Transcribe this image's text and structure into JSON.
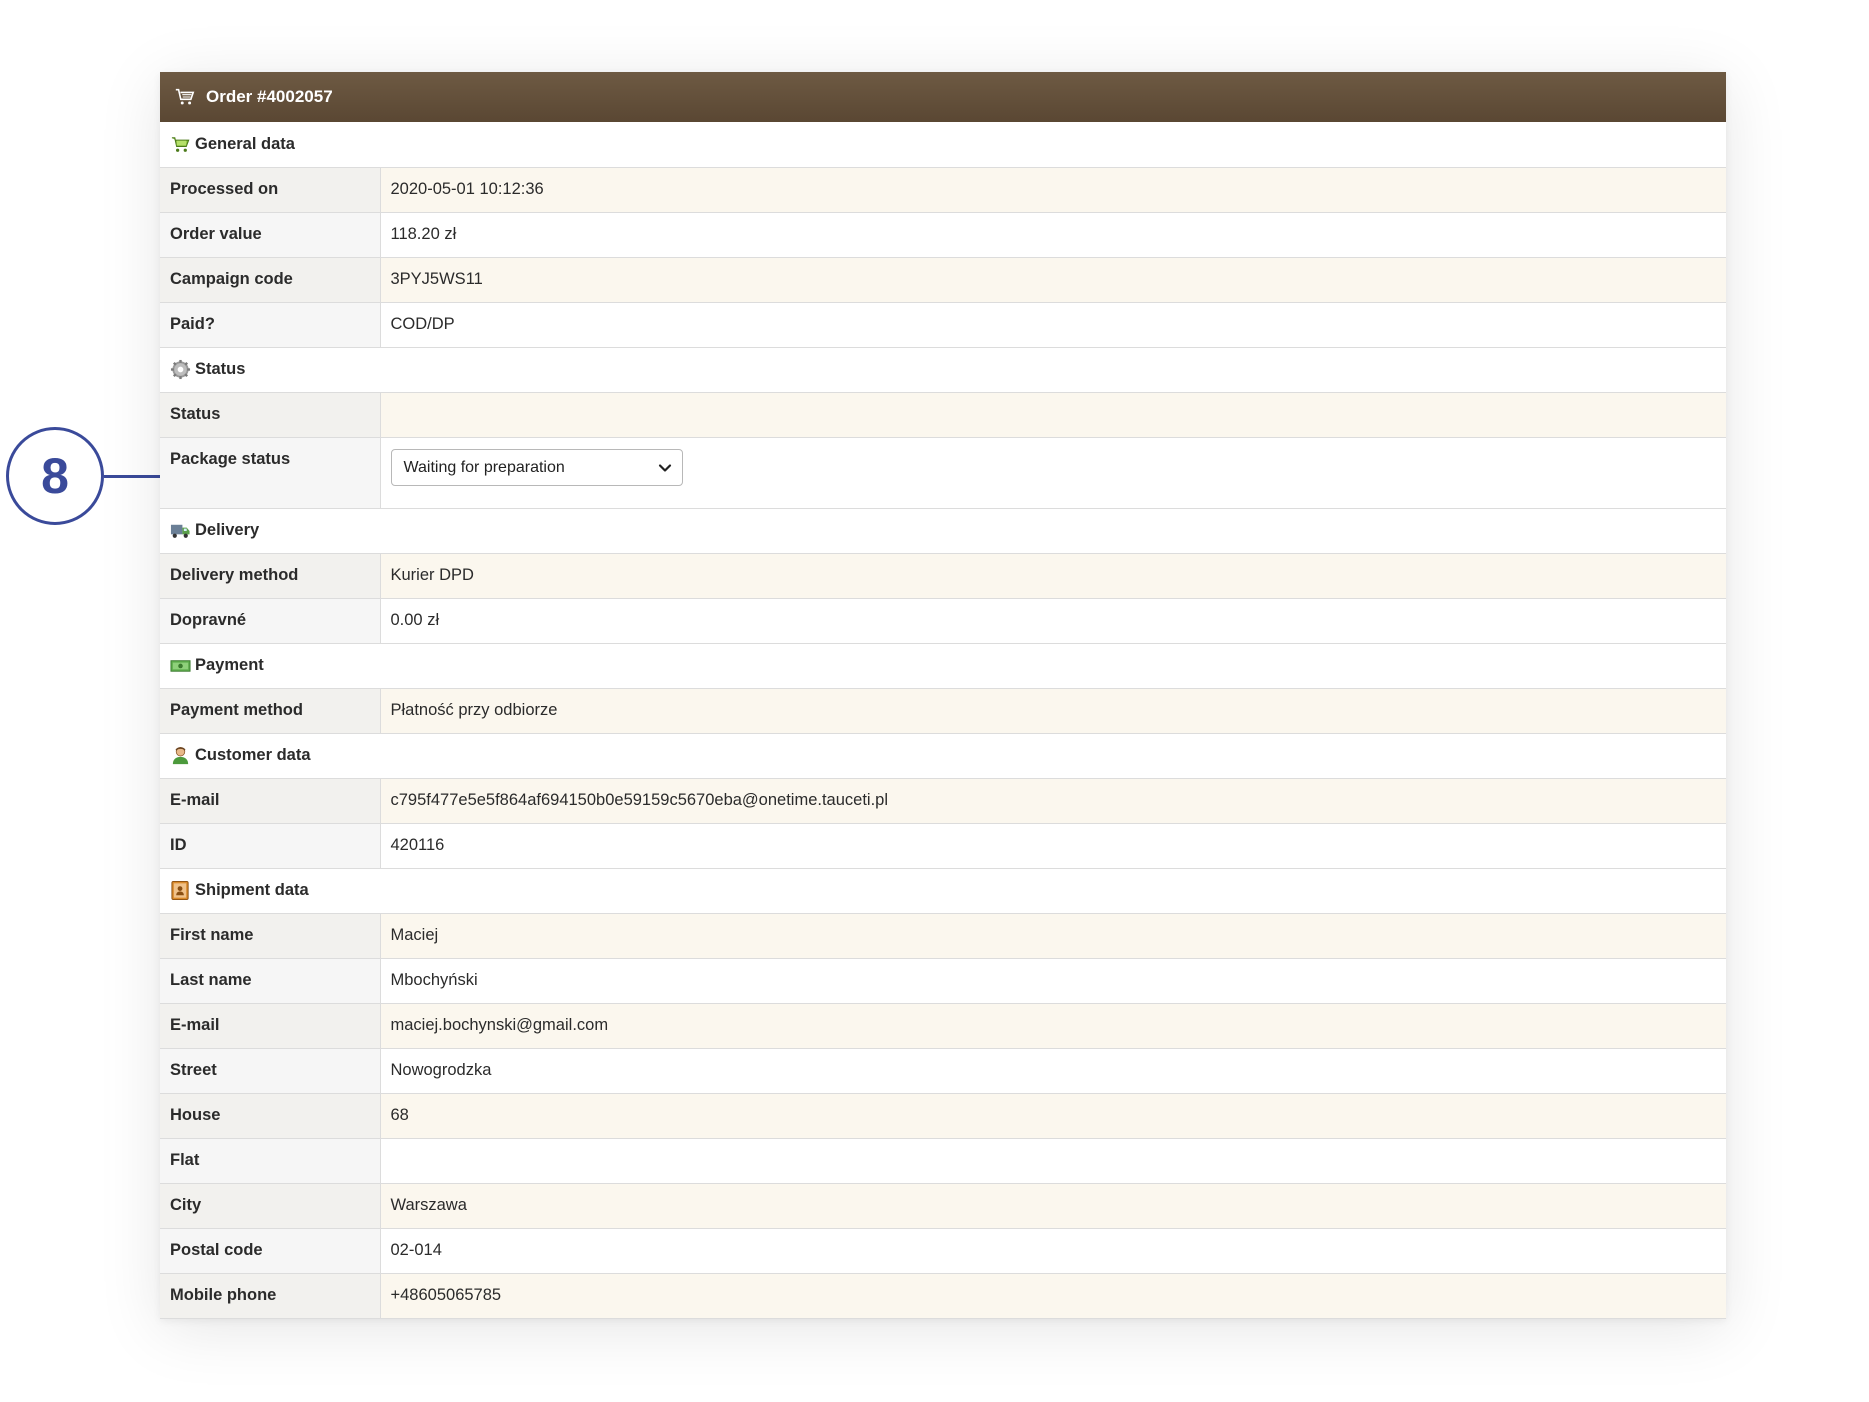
{
  "window": {
    "title": "Order #4002057",
    "title_icon": "cart-icon"
  },
  "callout": {
    "number": "8"
  },
  "sections": {
    "general": {
      "title": "General data",
      "icon": "cart-green-icon",
      "rows": [
        {
          "label": "Processed on",
          "value": "2020-05-01 10:12:36"
        },
        {
          "label": "Order value",
          "value": "118.20 zł"
        },
        {
          "label": "Campaign code",
          "value": "3PYJ5WS11"
        },
        {
          "label": "Paid?",
          "value": "COD/DP"
        }
      ]
    },
    "status": {
      "title": "Status",
      "icon": "gear-icon",
      "rows": [
        {
          "label": "Status",
          "value": ""
        },
        {
          "label": "Package status",
          "selected": "Waiting for preparation"
        }
      ]
    },
    "delivery": {
      "title": "Delivery",
      "icon": "truck-icon",
      "rows": [
        {
          "label": "Delivery method",
          "value": "Kurier DPD"
        },
        {
          "label": "Dopravné",
          "value": "0.00 zł"
        }
      ]
    },
    "payment": {
      "title": "Payment",
      "icon": "banknote-icon",
      "rows": [
        {
          "label": "Payment method",
          "value": "Płatność przy odbiorze"
        }
      ]
    },
    "customer": {
      "title": "Customer data",
      "icon": "user-icon",
      "rows": [
        {
          "label": "E-mail",
          "value": "c795f477e5e5f864af694150b0e59159c5670eba@onetime.tauceti.pl"
        },
        {
          "label": "ID",
          "value": "420116"
        }
      ]
    },
    "shipment": {
      "title": "Shipment data",
      "icon": "address-book-icon",
      "rows": [
        {
          "label": "First name",
          "value": "Maciej"
        },
        {
          "label": "Last name",
          "value": "Mbochyński"
        },
        {
          "label": "E-mail",
          "value": "maciej.bochynski@gmail.com"
        },
        {
          "label": "Street",
          "value": "Nowogrodzka"
        },
        {
          "label": "House",
          "value": "68"
        },
        {
          "label": "Flat",
          "value": ""
        },
        {
          "label": "City",
          "value": "Warszawa"
        },
        {
          "label": "Postal code",
          "value": "02-014"
        },
        {
          "label": "Mobile phone",
          "value": "+48605065785"
        }
      ]
    }
  },
  "colors": {
    "titlebar": "#5f4c38",
    "row_alt": "#fbf7ee",
    "callout": "#3a4a9a"
  }
}
